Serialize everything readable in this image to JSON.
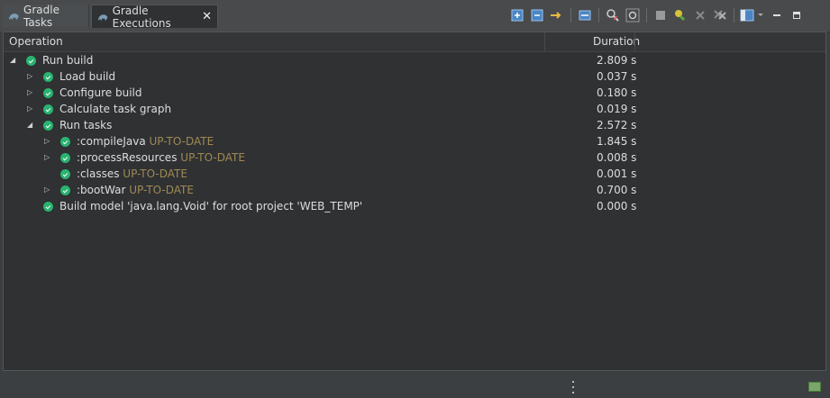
{
  "tabs": [
    {
      "label": "Gradle Tasks",
      "active": false
    },
    {
      "label": "Gradle Executions",
      "active": true
    }
  ],
  "toolbar": {
    "icons": [
      "expand-all-icon",
      "collapse-all-icon",
      "link-with-console-icon",
      "show-console-icon",
      "filter-icon",
      "rerun-icon",
      "cancel-icon",
      "rerun-failed-icon",
      "remove-icon",
      "remove-all-icon",
      "view-menu-icon",
      "minimize-icon",
      "maximize-icon"
    ]
  },
  "columns": {
    "operation": "Operation",
    "duration": "Duration"
  },
  "rows": [
    {
      "label": "Run build",
      "tag": "",
      "duration": "2.809 s",
      "twisty": "expanded",
      "depth": 0
    },
    {
      "label": "Load build",
      "tag": "",
      "duration": "0.037 s",
      "twisty": "collapsed",
      "depth": 1
    },
    {
      "label": "Configure build",
      "tag": "",
      "duration": "0.180 s",
      "twisty": "collapsed",
      "depth": 1
    },
    {
      "label": "Calculate task graph",
      "tag": "",
      "duration": "0.019 s",
      "twisty": "collapsed",
      "depth": 1
    },
    {
      "label": "Run tasks",
      "tag": "",
      "duration": "2.572 s",
      "twisty": "expanded",
      "depth": 1
    },
    {
      "label": ":compileJava",
      "tag": "UP-TO-DATE",
      "duration": "1.845 s",
      "twisty": "collapsed",
      "depth": 2
    },
    {
      "label": ":processResources",
      "tag": "UP-TO-DATE",
      "duration": "0.008 s",
      "twisty": "collapsed",
      "depth": 2
    },
    {
      "label": ":classes",
      "tag": "UP-TO-DATE",
      "duration": "0.001 s",
      "twisty": "none",
      "depth": 2
    },
    {
      "label": ":bootWar",
      "tag": "UP-TO-DATE",
      "duration": "0.700 s",
      "twisty": "collapsed",
      "depth": 2
    },
    {
      "label": "Build model 'java.lang.Void' for root project 'WEB_TEMP'",
      "tag": "",
      "duration": "0.000 s",
      "twisty": "none",
      "depth": 1
    }
  ]
}
